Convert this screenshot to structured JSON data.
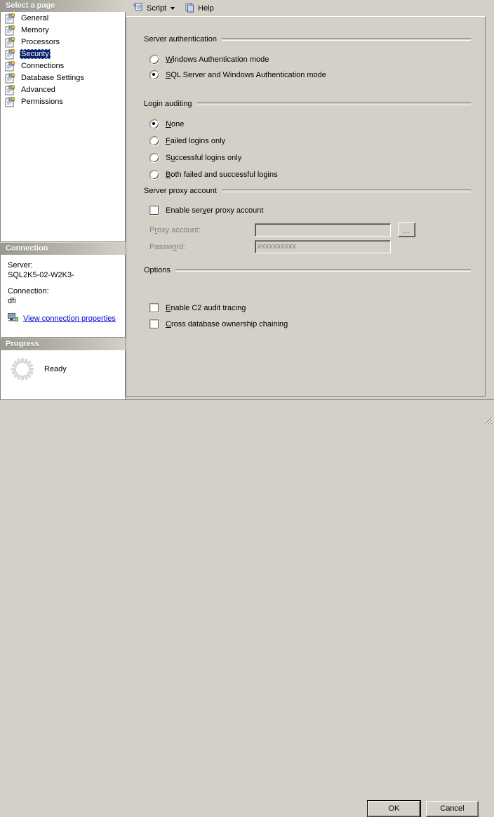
{
  "left": {
    "pages_header": "Select a page",
    "pages": [
      {
        "label": "General",
        "selected": false
      },
      {
        "label": "Memory",
        "selected": false
      },
      {
        "label": "Processors",
        "selected": false
      },
      {
        "label": "Security",
        "selected": true
      },
      {
        "label": "Connections",
        "selected": false
      },
      {
        "label": "Database Settings",
        "selected": false
      },
      {
        "label": "Advanced",
        "selected": false
      },
      {
        "label": "Permissions",
        "selected": false
      }
    ],
    "connection_header": "Connection",
    "server_label": "Server:",
    "server_value": "SQL2K5-02-W2K3-",
    "connection_label": "Connection:",
    "connection_value": "dfi",
    "view_connection_link": "View connection properties",
    "progress_header": "Progress",
    "progress_status": "Ready"
  },
  "toolbar": {
    "script_label": "Script",
    "help_label": "Help"
  },
  "content": {
    "server_auth": {
      "title": "Server authentication",
      "options": [
        {
          "pre": "",
          "accel": "W",
          "post": "indows Authentication mode",
          "checked": false
        },
        {
          "pre": "",
          "accel": "S",
          "post": "QL Server and Windows Authentication mode",
          "checked": true
        }
      ]
    },
    "login_auditing": {
      "title": "Login auditing",
      "options": [
        {
          "pre": "",
          "accel": "N",
          "post": "one",
          "checked": true
        },
        {
          "pre": "",
          "accel": "F",
          "post": "ailed logins only",
          "checked": false
        },
        {
          "pre": "S",
          "accel": "u",
          "post": "ccessful logins only",
          "checked": false
        },
        {
          "pre": "",
          "accel": "B",
          "post": "oth failed and successful logins",
          "checked": false
        }
      ]
    },
    "proxy": {
      "title": "Server proxy account",
      "enable": {
        "pre": "Enable ser",
        "accel": "v",
        "post": "er proxy account",
        "checked": false
      },
      "account_label_pre": "P",
      "account_label_accel": "r",
      "account_label_post": "oxy account:",
      "account_value": "",
      "browse_label": "...",
      "password_label_pre": "Passw",
      "password_label_accel": "o",
      "password_label_post": "rd:",
      "password_value": "xxxxxxxxxx"
    },
    "options": {
      "title": "Options",
      "checks": [
        {
          "pre": "",
          "accel": "E",
          "post": "nable C2 audit tracing",
          "checked": false
        },
        {
          "pre": "",
          "accel": "C",
          "post": "ross database ownership chaining",
          "checked": false
        }
      ]
    }
  },
  "buttons": {
    "ok": "OK",
    "cancel": "Cancel"
  },
  "colors": {
    "face": "#d4d0c8",
    "selection": "#0a246a",
    "link": "#0000d4",
    "disabled": "#808080"
  }
}
